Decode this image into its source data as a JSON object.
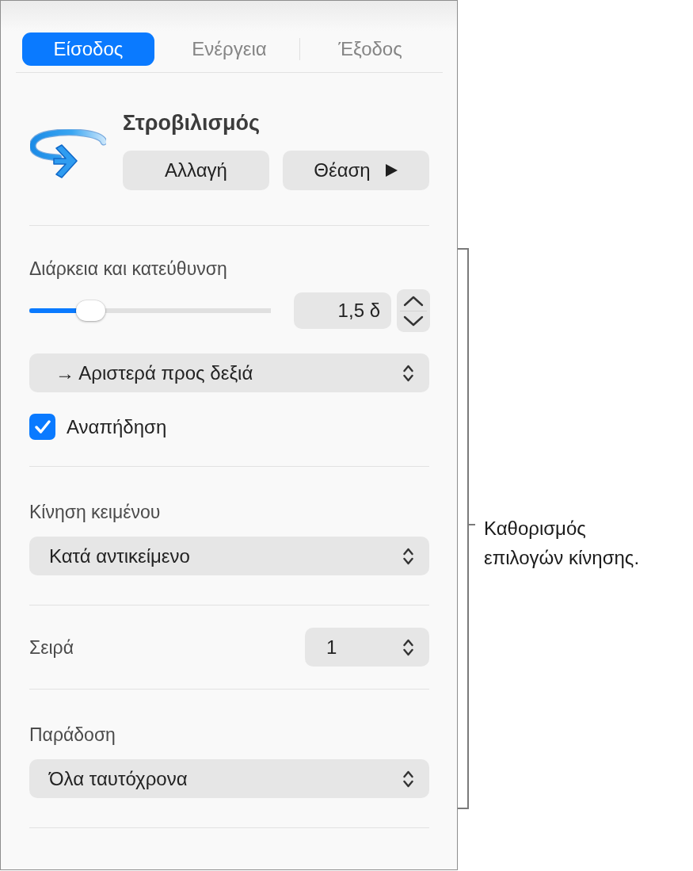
{
  "tabs": [
    {
      "label": "Είσοδος",
      "selected": true
    },
    {
      "label": "Ενέργεια",
      "selected": false
    },
    {
      "label": "Έξοδος",
      "selected": false
    }
  ],
  "effect": {
    "title": "Στροβιλισμός",
    "buttons": [
      {
        "label": "Αλλαγή",
        "kind": "plain"
      },
      {
        "label": "Θέαση",
        "kind": "play"
      }
    ]
  },
  "sections": [
    {
      "kind": "duration",
      "heading": "Διάρκεια και κατεύθυνση",
      "slider": {
        "level": 0.22
      },
      "duration": "1,5 δ",
      "direction": "→ Αριστερά προς δεξιά",
      "checkbox": {
        "label": "Αναπήδηση",
        "checked": true
      }
    },
    {
      "kind": "popup",
      "heading": "Κίνηση κειμένου",
      "value": "Κατά αντικείμενο"
    },
    {
      "kind": "inline",
      "heading": "Σειρά",
      "value": "1"
    },
    {
      "kind": "popup",
      "heading": "Παράδοση",
      "value": "Όλα ταυτόχρονα"
    }
  ],
  "callout": "Καθορισμός επιλογών κίνησης."
}
